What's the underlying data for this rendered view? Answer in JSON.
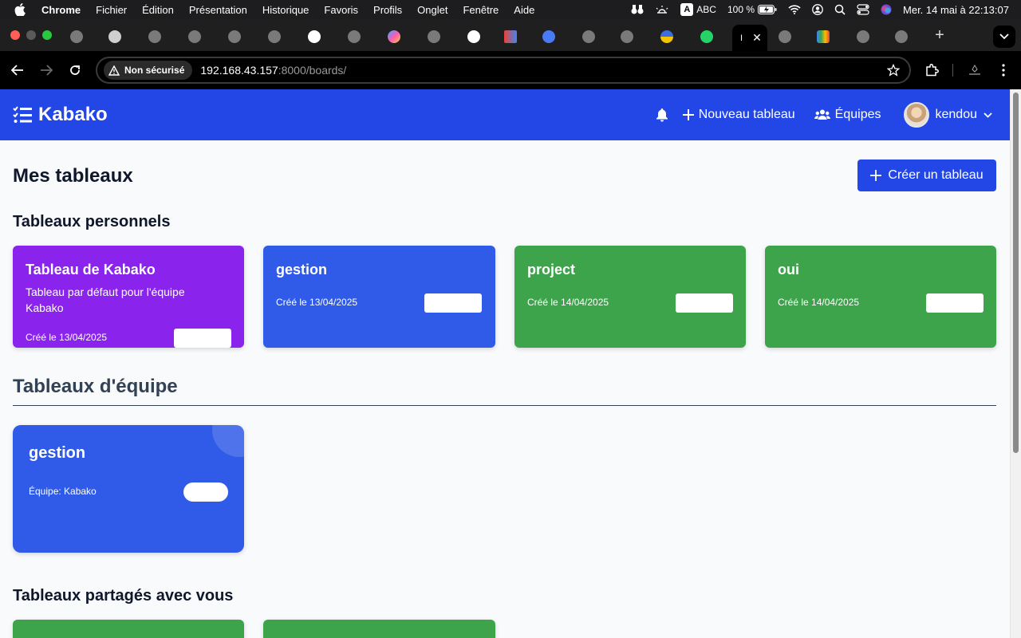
{
  "menubar": {
    "app": "Chrome",
    "items": [
      "Fichier",
      "Édition",
      "Présentation",
      "Historique",
      "Favoris",
      "Profils",
      "Onglet",
      "Fenêtre",
      "Aide"
    ],
    "keyboard": "ABC",
    "battery": "100 %",
    "datetime": "Mer. 14 mai à  22:13:07"
  },
  "browser": {
    "security_label": "Non sécurisé",
    "url_host": "192.168.43.157",
    "url_path": ":8000/boards/",
    "active_tab_label": "I"
  },
  "app": {
    "brand": "Kabako",
    "nav": {
      "new_board": "Nouveau tableau",
      "teams": "Équipes",
      "user": "kendou"
    }
  },
  "main": {
    "title": "Mes tableaux",
    "create_button": "Créer un tableau",
    "personal_title": "Tableaux personnels",
    "team_title": "Tableaux d'équipe",
    "shared_title": "Tableaux partagés avec vous",
    "personal_boards": [
      {
        "title": "Tableau de Kabako",
        "description": "Tableau par défaut pour l'équipe Kabako",
        "date": "Créé le 13/04/2025",
        "color": "#8a23ec"
      },
      {
        "title": "gestion",
        "description": "",
        "date": "Créé le 13/04/2025",
        "color": "#2f5be8"
      },
      {
        "title": "project",
        "description": "",
        "date": "Créé le 14/04/2025",
        "color": "#3ea44b"
      },
      {
        "title": "oui",
        "description": "",
        "date": "Créé le 14/04/2025",
        "color": "#3ea44b"
      }
    ],
    "team_boards": [
      {
        "title": "gestion",
        "team": "Équipe: Kabako",
        "color": "#2f5be8"
      }
    ],
    "shared_boards_colors": [
      "#3ea44b",
      "#3ea44b"
    ]
  }
}
